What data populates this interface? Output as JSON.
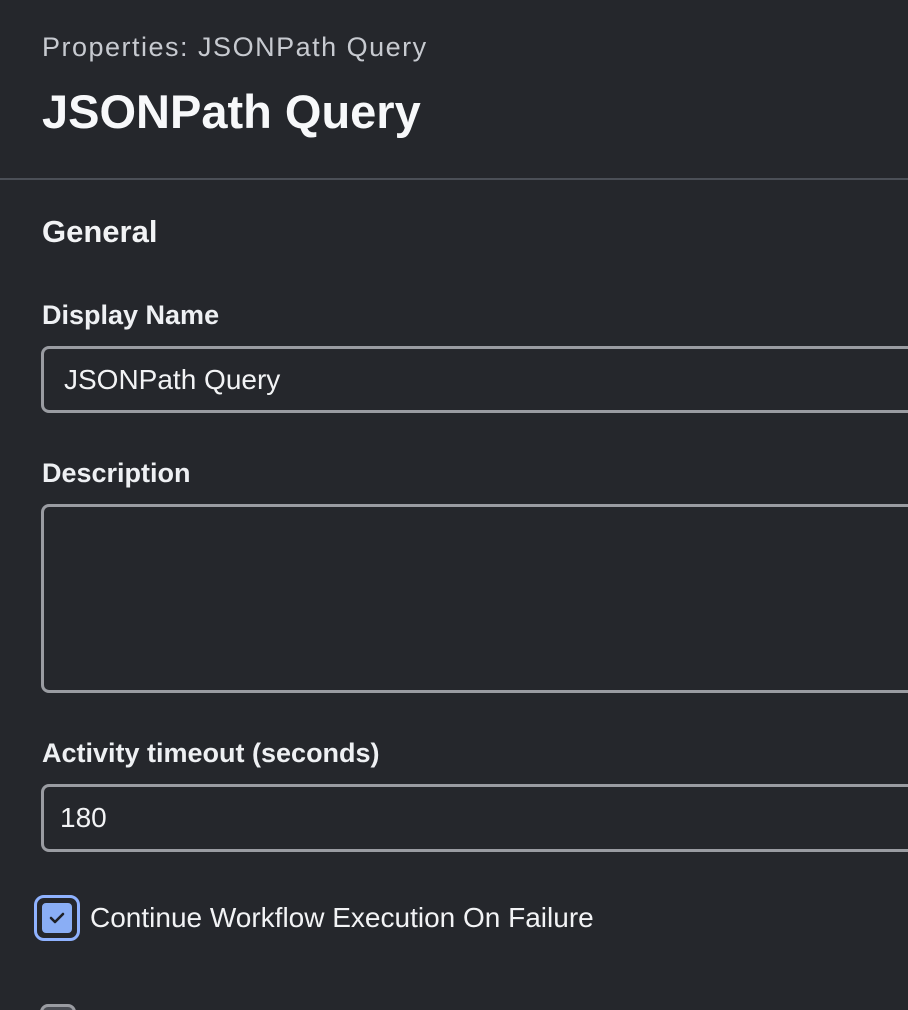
{
  "header": {
    "subtitle": "Properties: JSONPath Query",
    "title": "JSONPath Query"
  },
  "general": {
    "section_title": "General",
    "display_name": {
      "label": "Display Name",
      "value": "JSONPath Query"
    },
    "description": {
      "label": "Description",
      "value": ""
    },
    "activity_timeout": {
      "label": "Activity timeout (seconds)",
      "value": "180"
    },
    "continue_on_failure": {
      "label": "Continue Workflow Execution On Failure",
      "checked": true
    },
    "next_option": {
      "label": "",
      "checked": false
    }
  },
  "colors": {
    "background": "#25272c",
    "accent": "#8aaef5",
    "border": "#9a9ca2"
  }
}
